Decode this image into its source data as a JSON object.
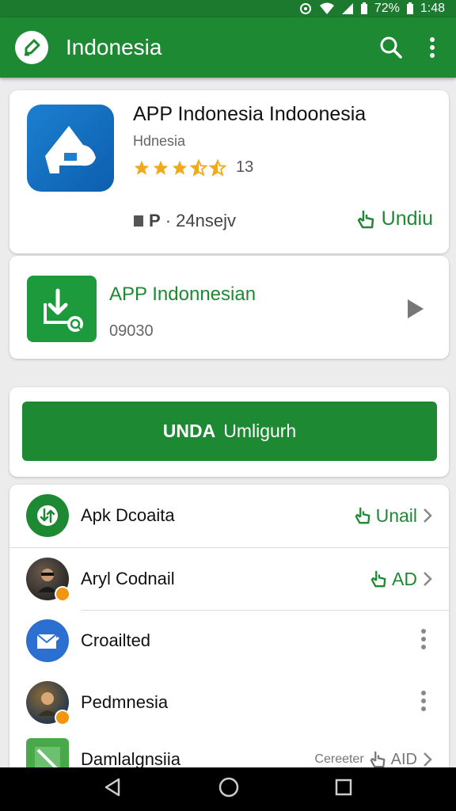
{
  "status": {
    "battery": "72%",
    "time": "1:48"
  },
  "toolbar": {
    "title": "Indonesia",
    "search_icon": "search-icon",
    "more_icon": "more-vert-icon"
  },
  "app_card": {
    "name": "APP Indonesia Indoonesia",
    "subtitle": "Hdnesia",
    "rating": 3.5,
    "rating_count": "13",
    "meta_prefix": "P",
    "meta_text": "· 24nsejv",
    "download_label": "Undiu"
  },
  "item_card": {
    "name": "APP Indonnesian",
    "code": "09030"
  },
  "big_button": {
    "label_bold": "UNDA",
    "label_rest": "Umligurh"
  },
  "list": [
    {
      "label": "Apk Dcoaita",
      "action": "Unail",
      "type": "download"
    },
    {
      "label": "Aryl Codnail",
      "action": "AD",
      "type": "download"
    },
    {
      "label": "Croailted",
      "type": "menu"
    },
    {
      "label": "Pedmnesia",
      "type": "menu"
    },
    {
      "label": "Damlalgnsiia",
      "action_prefix": "Cereeter",
      "action": "AID",
      "type": "download"
    }
  ],
  "colors": {
    "primary": "#1d8a33",
    "primary_dark": "#1b7a2e",
    "star": "#f0a91b"
  }
}
